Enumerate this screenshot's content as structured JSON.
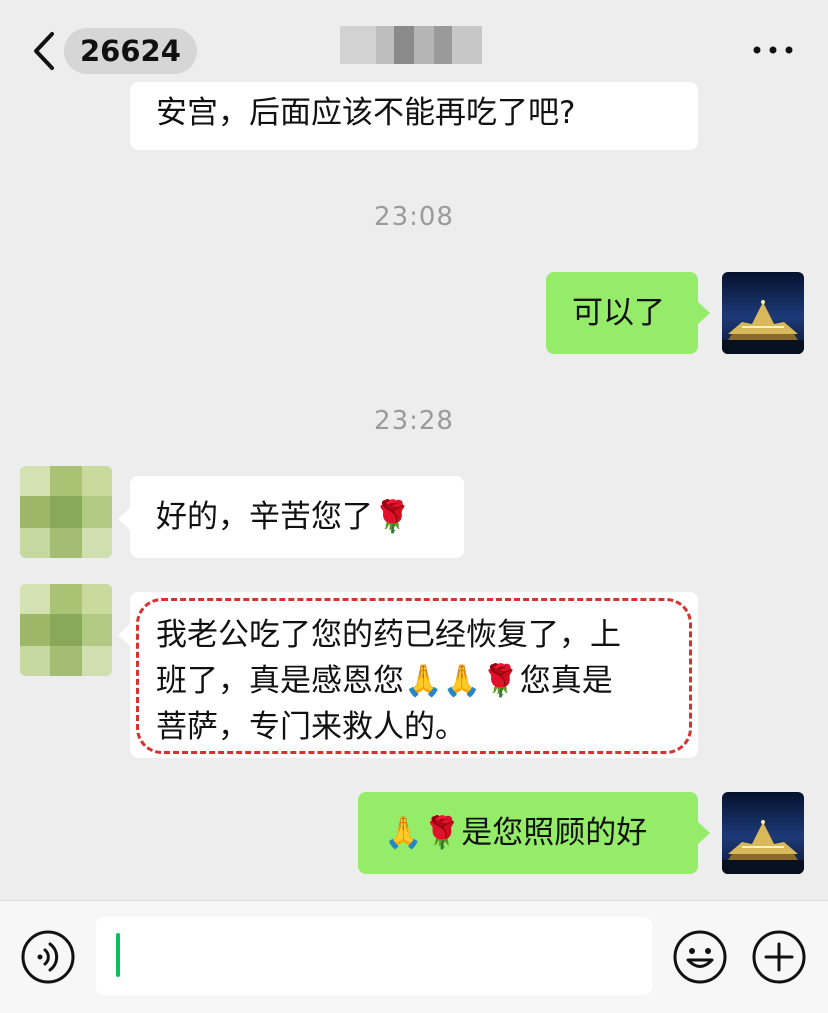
{
  "header": {
    "unread_badge": "26624"
  },
  "messages": [
    {
      "text": "安宫，后面应该不能再吃了吧?"
    },
    {
      "time": "23:08"
    },
    {
      "text": "可以了"
    },
    {
      "time": "23:28"
    },
    {
      "text": "好的，辛苦您了🌹"
    },
    {
      "lines": [
        "我老公吃了您的药已经恢复了，上",
        "班了，真是感恩您🙏🙏🌹您真是",
        "菩萨，专门来救人的。"
      ]
    },
    {
      "text": "🙏🌹是您照顾的好"
    }
  ],
  "colors": {
    "background": "#ededed",
    "self_bubble": "#95ec69",
    "other_bubble": "#ffffff",
    "highlight_dash": "#d6322f",
    "caret": "#07c160"
  }
}
